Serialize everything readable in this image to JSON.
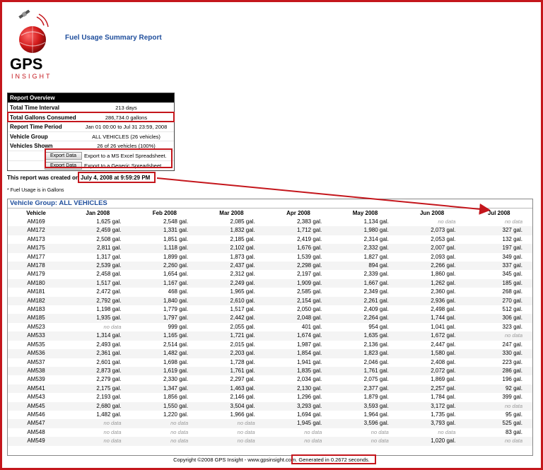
{
  "header": {
    "logo_text": "GPS",
    "logo_sub": "INSIGHT",
    "title": "Fuel Usage Summary Report"
  },
  "overview": {
    "heading": "Report Overview",
    "rows": [
      {
        "label": "Total Time Interval",
        "value": "213 days"
      },
      {
        "label": "Total Gallons Consumed",
        "value": "286,734.0 gallons"
      },
      {
        "label": "Report Time Period",
        "value": "Jan 01 00:00 to Jul 31 23:59, 2008"
      },
      {
        "label": "Vehicle Group",
        "value": "ALL VEHICLES (26 vehicles)"
      },
      {
        "label": "Vehicles Shown",
        "value": "26 of 26 vehicles (100%)"
      }
    ],
    "exports": [
      {
        "button": "Export Data",
        "link": "Export to a MS Excel Spreadsheet."
      },
      {
        "button": "Export Data",
        "link": "Export to a Generic Spreadsheet."
      }
    ]
  },
  "created": {
    "prefix": "This report was created on",
    "date": "July 4, 2008 at 9:59:29 PM"
  },
  "note": "* Fuel Usage is in Gallons",
  "group": {
    "title": "Vehicle Group: ALL VEHICLES",
    "columns": [
      "Vehicle",
      "Jan 2008",
      "Feb 2008",
      "Mar 2008",
      "Apr 2008",
      "May 2008",
      "Jun 2008",
      "Jul 2008"
    ],
    "rows": [
      [
        "AM169",
        "1,625 gal.",
        "2,548 gal.",
        "2,085 gal.",
        "2,383 gal.",
        "1,134 gal.",
        "no data",
        "no data"
      ],
      [
        "AM172",
        "2,459 gal.",
        "1,331 gal.",
        "1,832 gal.",
        "1,712 gal.",
        "1,980 gal.",
        "2,073 gal.",
        "327 gal."
      ],
      [
        "AM173",
        "2,508 gal.",
        "1,851 gal.",
        "2,185 gal.",
        "2,419 gal.",
        "2,314 gal.",
        "2,053 gal.",
        "132 gal."
      ],
      [
        "AM175",
        "2,811 gal.",
        "1,118 gal.",
        "2,102 gal.",
        "1,676 gal.",
        "2,332 gal.",
        "2,007 gal.",
        "197 gal."
      ],
      [
        "AM177",
        "1,317 gal.",
        "1,899 gal.",
        "1,873 gal.",
        "1,539 gal.",
        "1,827 gal.",
        "2,093 gal.",
        "349 gal."
      ],
      [
        "AM178",
        "2,539 gal.",
        "2,260 gal.",
        "2,437 gal.",
        "2,298 gal.",
        "894 gal.",
        "2,266 gal.",
        "337 gal."
      ],
      [
        "AM179",
        "2,458 gal.",
        "1,654 gal.",
        "2,312 gal.",
        "2,197 gal.",
        "2,339 gal.",
        "1,860 gal.",
        "345 gal."
      ],
      [
        "AM180",
        "1,517 gal.",
        "1,167 gal.",
        "2,249 gal.",
        "1,909 gal.",
        "1,667 gal.",
        "1,262 gal.",
        "185 gal."
      ],
      [
        "AM181",
        "2,472 gal.",
        "468 gal.",
        "1,965 gal.",
        "2,585 gal.",
        "2,349 gal.",
        "2,360 gal.",
        "268 gal."
      ],
      [
        "AM182",
        "2,792 gal.",
        "1,840 gal.",
        "2,610 gal.",
        "2,154 gal.",
        "2,261 gal.",
        "2,936 gal.",
        "270 gal."
      ],
      [
        "AM183",
        "1,198 gal.",
        "1,779 gal.",
        "1,517 gal.",
        "2,050 gal.",
        "2,409 gal.",
        "2,498 gal.",
        "512 gal."
      ],
      [
        "AM185",
        "1,935 gal.",
        "1,797 gal.",
        "2,442 gal.",
        "2,048 gal.",
        "2,264 gal.",
        "1,744 gal.",
        "306 gal."
      ],
      [
        "AM523",
        "no data",
        "999 gal.",
        "2,055 gal.",
        "401 gal.",
        "954 gal.",
        "1,041 gal.",
        "323 gal."
      ],
      [
        "AM533",
        "1,314 gal.",
        "1,165 gal.",
        "1,721 gal.",
        "1,674 gal.",
        "1,635 gal.",
        "1,672 gal.",
        "no data"
      ],
      [
        "AM535",
        "2,493 gal.",
        "2,514 gal.",
        "2,015 gal.",
        "1,987 gal.",
        "2,136 gal.",
        "2,447 gal.",
        "247 gal."
      ],
      [
        "AM536",
        "2,361 gal.",
        "1,482 gal.",
        "2,203 gal.",
        "1,854 gal.",
        "1,823 gal.",
        "1,580 gal.",
        "330 gal."
      ],
      [
        "AM537",
        "2,601 gal.",
        "1,698 gal.",
        "1,728 gal.",
        "1,941 gal.",
        "2,046 gal.",
        "2,408 gal.",
        "223 gal."
      ],
      [
        "AM538",
        "2,873 gal.",
        "1,619 gal.",
        "1,761 gal.",
        "1,835 gal.",
        "1,761 gal.",
        "2,072 gal.",
        "286 gal."
      ],
      [
        "AM539",
        "2,279 gal.",
        "2,330 gal.",
        "2,297 gal.",
        "2,034 gal.",
        "2,075 gal.",
        "1,869 gal.",
        "196 gal."
      ],
      [
        "AM541",
        "2,175 gal.",
        "1,347 gal.",
        "1,463 gal.",
        "2,130 gal.",
        "2,377 gal.",
        "2,257 gal.",
        "92 gal."
      ],
      [
        "AM543",
        "2,193 gal.",
        "1,856 gal.",
        "2,146 gal.",
        "1,296 gal.",
        "1,879 gal.",
        "1,784 gal.",
        "399 gal."
      ],
      [
        "AM545",
        "2,680 gal.",
        "1,550 gal.",
        "3,504 gal.",
        "3,293 gal.",
        "3,593 gal.",
        "3,172 gal.",
        "no data"
      ],
      [
        "AM546",
        "1,482 gal.",
        "1,220 gal.",
        "1,966 gal.",
        "1,694 gal.",
        "1,964 gal.",
        "1,735 gal.",
        "95 gal."
      ],
      [
        "AM547",
        "no data",
        "no data",
        "no data",
        "1,945 gal.",
        "3,596 gal.",
        "3,793 gal.",
        "525 gal."
      ],
      [
        "AM548",
        "no data",
        "no data",
        "no data",
        "no data",
        "no data",
        "no data",
        "83 gal."
      ],
      [
        "AM549",
        "no data",
        "no data",
        "no data",
        "no data",
        "no data",
        "1,020 gal.",
        "no data"
      ]
    ]
  },
  "footer": {
    "copyright": "Copyright ©2008 GPS Insight - www.gpsinsight.com.",
    "generated": "Generated in 0.2672 seconds."
  },
  "colors": {
    "accent_red": "#c4161c",
    "title_blue": "#1f4e9c",
    "nodata_gray": "#9a9a9a"
  },
  "icons": {
    "logo": "satellite-globe-icon",
    "annotation": "red-arrow-icon"
  }
}
